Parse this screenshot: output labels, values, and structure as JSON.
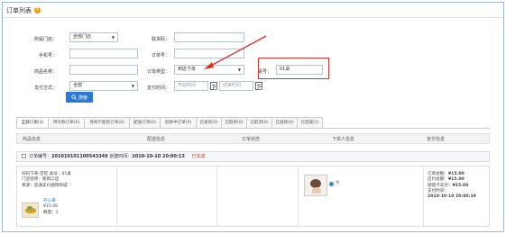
{
  "header": {
    "title": "订单列表",
    "help_glyph": "?"
  },
  "filters": {
    "store_label": "所属门店：",
    "store_value": "全部门店",
    "pickup_label": "取货码：",
    "phone_label": "手机号：",
    "order_no_label": "订单号：",
    "product_label": "商品名称：",
    "order_type_label": "订单类型：",
    "order_type_value": "到店下单",
    "table_label": "桌号：",
    "table_value": "01桌",
    "pay_label": "支付方式：",
    "pay_value": "全部",
    "pay_time_label": "支付时间：",
    "start_placeholder": "开始时间",
    "end_placeholder": "结束时间",
    "search_label": "搜索"
  },
  "tabs": [
    "全部订单(1)",
    "待付款订单(0)",
    "待商户配货订单(0)",
    "配送订单(0)",
    "退款中订单(0)",
    "已发货(0)",
    "已取货(0)",
    "已取消(0)",
    "已退款(0)",
    "已完成(1)"
  ],
  "columns": [
    "商品信息",
    "配送信息",
    "订单状态",
    "下单人信息",
    "支付信息"
  ],
  "order": {
    "number_label": "订单编号：",
    "number": "201010101100543349",
    "created_label": "创建时间：",
    "created": "2010-10-10 20:00:13",
    "status": "已完成",
    "info_lines": [
      "扫码下单-堂吃 桌号：01桌",
      "门店名称：新街口店",
      "来源：店通支付通用商城"
    ],
    "product_name": "开心果",
    "product_price": "¥15.00",
    "product_qty": "数量：1",
    "buyer_name": "大",
    "pay_lines": [
      {
        "label": "订单总额：",
        "value": "¥15.00"
      },
      {
        "label": "应付总额：",
        "value": "¥15.00"
      },
      {
        "label": "储值卡支付：",
        "value": "¥15.00"
      },
      {
        "label": "支付时间：",
        "value": ""
      },
      {
        "label": "",
        "value": "2010-10-10 20:00:19"
      }
    ]
  },
  "colors": {
    "accent": "#2b7bd6",
    "highlight_box": "#d9302b",
    "arrow": "#d9302b",
    "status": "#e03a2f"
  }
}
